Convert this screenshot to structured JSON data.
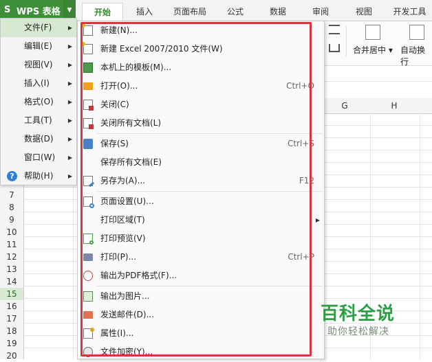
{
  "app": {
    "name": "WPS 表格",
    "logo_glyph": "S"
  },
  "ribbon_tabs": [
    {
      "label": "开始",
      "active": true
    },
    {
      "label": "插入",
      "active": false
    },
    {
      "label": "页面布局",
      "active": false
    },
    {
      "label": "公式",
      "active": false
    },
    {
      "label": "数据",
      "active": false
    },
    {
      "label": "审阅",
      "active": false
    },
    {
      "label": "视图",
      "active": false
    },
    {
      "label": "开发工具",
      "active": false
    }
  ],
  "ribbon": {
    "merge_center": "合并居中",
    "auto_wrap": "自动换行"
  },
  "columns": [
    "G",
    "H"
  ],
  "rows": [
    "7",
    "8",
    "9",
    "10",
    "11",
    "12",
    "13",
    "14",
    "15",
    "16",
    "17",
    "18",
    "19",
    "20"
  ],
  "selected_row": "15",
  "main_menu": {
    "items": [
      {
        "label": "文件(F)",
        "highlight": true
      },
      {
        "label": "编辑(E)"
      },
      {
        "label": "视图(V)"
      },
      {
        "label": "插入(I)"
      },
      {
        "label": "格式(O)"
      },
      {
        "label": "工具(T)"
      },
      {
        "label": "数据(D)"
      },
      {
        "label": "窗口(W)"
      },
      {
        "label": "帮助(H)",
        "icon": "help-icon"
      }
    ],
    "help_glyph": "?"
  },
  "file_menu": {
    "items": [
      {
        "label": "新建(N)...",
        "icon": "new-document-icon"
      },
      {
        "label": "新建 Excel 2007/2010 文件(W)",
        "icon": "new-excel-icon"
      },
      {
        "label": "本机上的模板(M)...",
        "icon": "template-icon"
      },
      {
        "label": "打开(O)...",
        "shortcut": "Ctrl+O",
        "icon": "folder-open-icon"
      },
      {
        "label": "关闭(C)",
        "icon": "close-document-icon"
      },
      {
        "label": "关闭所有文档(L)",
        "icon": "close-all-icon"
      },
      {
        "label": "保存(S)",
        "shortcut": "Ctrl+S",
        "icon": "save-icon"
      },
      {
        "label": "保存所有文档(E)"
      },
      {
        "label": "另存为(A)...",
        "shortcut": "F12",
        "icon": "save-as-icon"
      },
      {
        "label": "页面设置(U)...",
        "icon": "page-setup-icon"
      },
      {
        "label": "打印区域(T)",
        "submenu": true
      },
      {
        "label": "打印预览(V)",
        "icon": "print-preview-icon"
      },
      {
        "label": "打印(P)...",
        "shortcut": "Ctrl+P",
        "icon": "print-icon"
      },
      {
        "label": "输出为PDF格式(F)...",
        "icon": "pdf-icon"
      },
      {
        "label": "输出为图片...",
        "icon": "image-export-icon"
      },
      {
        "label": "发送邮件(D)...",
        "icon": "mail-icon"
      },
      {
        "label": "属性(I)...",
        "icon": "properties-icon"
      },
      {
        "label": "文件加密(Y)...",
        "icon": "encrypt-icon"
      }
    ]
  },
  "watermark": {
    "title": "百科全说",
    "subtitle": "助你轻松解决"
  },
  "colors": {
    "brand_green": "#3f8e3a",
    "highlight_red": "#d8353d",
    "watermark_green": "#2e9e46"
  }
}
